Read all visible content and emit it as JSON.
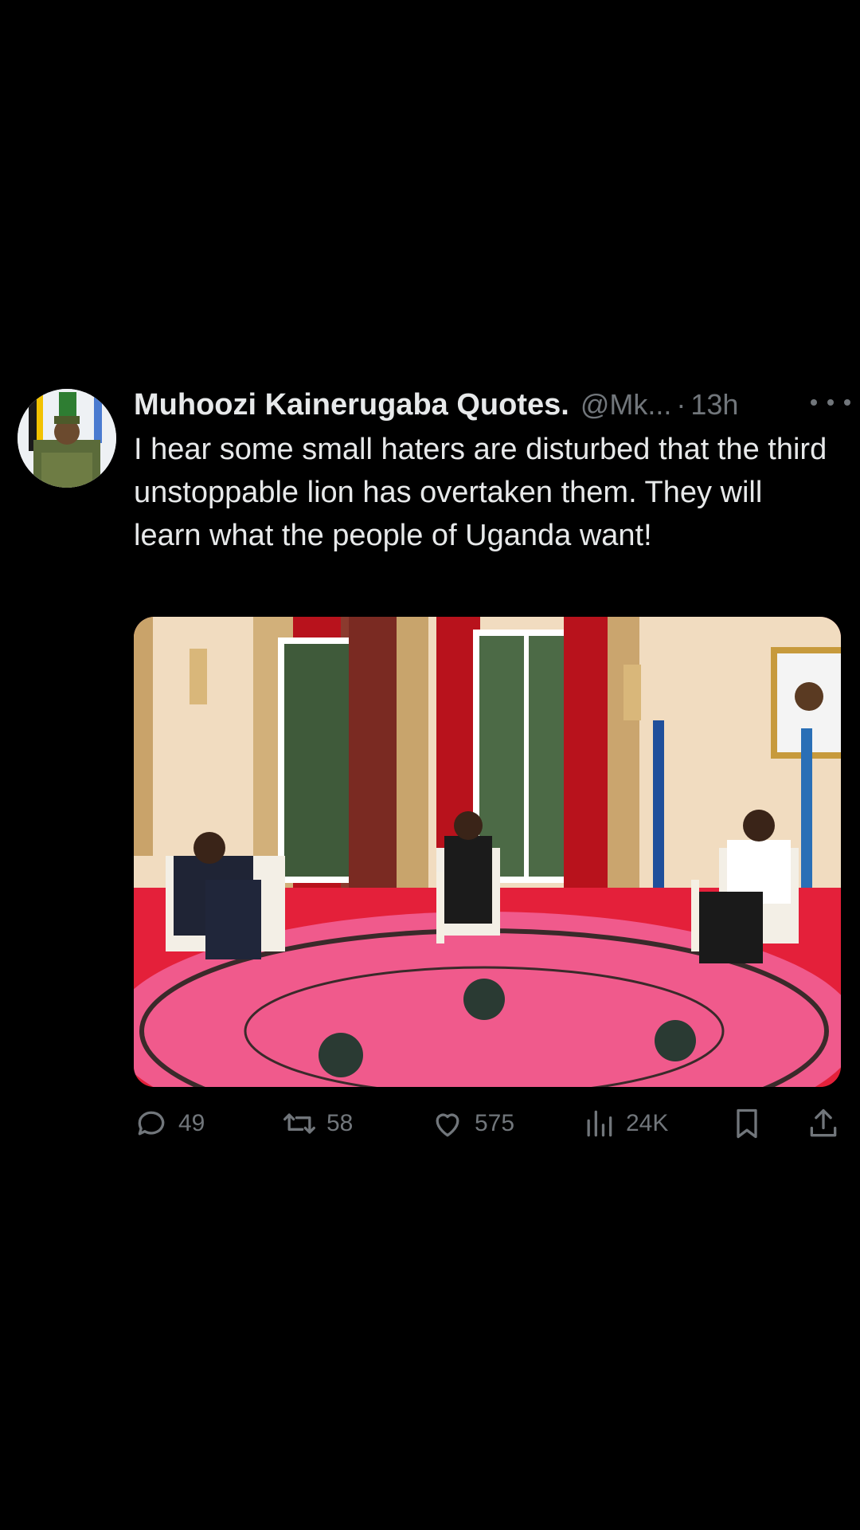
{
  "tweet": {
    "author_name": "Muhoozi Kainerugaba Quotes.",
    "handle": "@Mk...",
    "separator": "·",
    "time": "13h",
    "text": "I hear some small haters are disturbed that the third unstoppable lion has overtaken them. They will learn what the people of Uganda want!"
  },
  "actions": {
    "replies": "49",
    "retweets": "58",
    "likes": "575",
    "views": "24K"
  },
  "icons": [
    "more-icon",
    "reply-icon",
    "retweet-icon",
    "like-icon",
    "views-icon",
    "bookmark-icon",
    "share-icon"
  ],
  "colors": {
    "background": "#000000",
    "text": "#e7e9ea",
    "secondary": "#71767b"
  }
}
